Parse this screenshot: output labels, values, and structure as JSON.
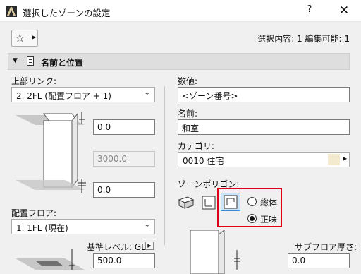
{
  "window": {
    "title": "選択したゾーンの設定",
    "help_label": "?",
    "close_label": "✕"
  },
  "toolbar": {
    "favorites_icon": "star-icon",
    "selection_info": "選択内容: 1 編集可能: 1"
  },
  "section": {
    "title": "名前と位置"
  },
  "left": {
    "top_link_label": "上部リンク:",
    "top_link_value": "2. 2FL (配置フロア + 1)",
    "top_offset": "0.0",
    "height": "3000.0",
    "bottom_offset": "0.0",
    "home_floor_label": "配置フロア:",
    "home_floor_value": "1. 1FL (現在)",
    "ref_level_label": "基準レベル: GL",
    "ref_level_value": "500.0"
  },
  "right": {
    "number_label": "数値:",
    "number_value": "<ゾーン番号>",
    "name_label": "名前:",
    "name_value": "和室",
    "category_label": "カテゴリ:",
    "category_value": "0010  住宅",
    "category_color": "#f3ead0",
    "polygon_label": "ゾーンポリゴン:",
    "radio_gross": "総体",
    "radio_net": "正味",
    "subfloor_label": "サブフロア厚さ:",
    "subfloor_value": "0.0"
  },
  "colors": {
    "highlight": "#e0001a",
    "selected_bg": "#cce4f7",
    "selected_border": "#3a8ad8"
  }
}
